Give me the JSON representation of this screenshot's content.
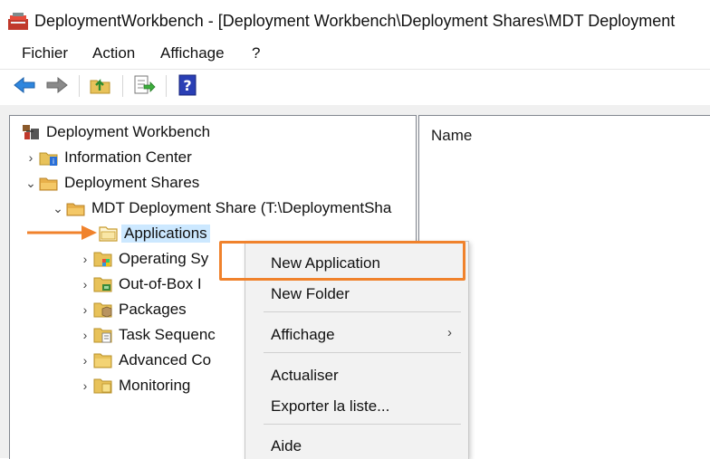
{
  "window": {
    "title": "DeploymentWorkbench - [Deployment Workbench\\Deployment Shares\\MDT Deployment"
  },
  "menubar": {
    "items": [
      "Fichier",
      "Action",
      "Affichage",
      "?"
    ]
  },
  "toolbar": {
    "buttons": [
      "back-arrow-icon",
      "forward-arrow-icon",
      "up-folder-icon",
      "export-list-icon",
      "help-icon"
    ]
  },
  "tree": {
    "root": "Deployment Workbench",
    "info_center": "Information Center",
    "deployment_shares": "Deployment Shares",
    "mdt_share": "MDT Deployment Share (T:\\DeploymentSha",
    "applications": "Applications",
    "operating_systems": "Operating Sy",
    "out_of_box": "Out-of-Box I",
    "packages": "Packages",
    "task_sequences": "Task Sequenc",
    "advanced_config": "Advanced Co",
    "monitoring": "Monitoring"
  },
  "list": {
    "column_name": "Name"
  },
  "context_menu": {
    "new_application": "New Application",
    "new_folder": "New Folder",
    "affichage": "Affichage",
    "actualiser": "Actualiser",
    "exporter": "Exporter la liste...",
    "aide": "Aide"
  },
  "colors": {
    "highlight": "#f0822c",
    "selection": "#cce8ff"
  }
}
